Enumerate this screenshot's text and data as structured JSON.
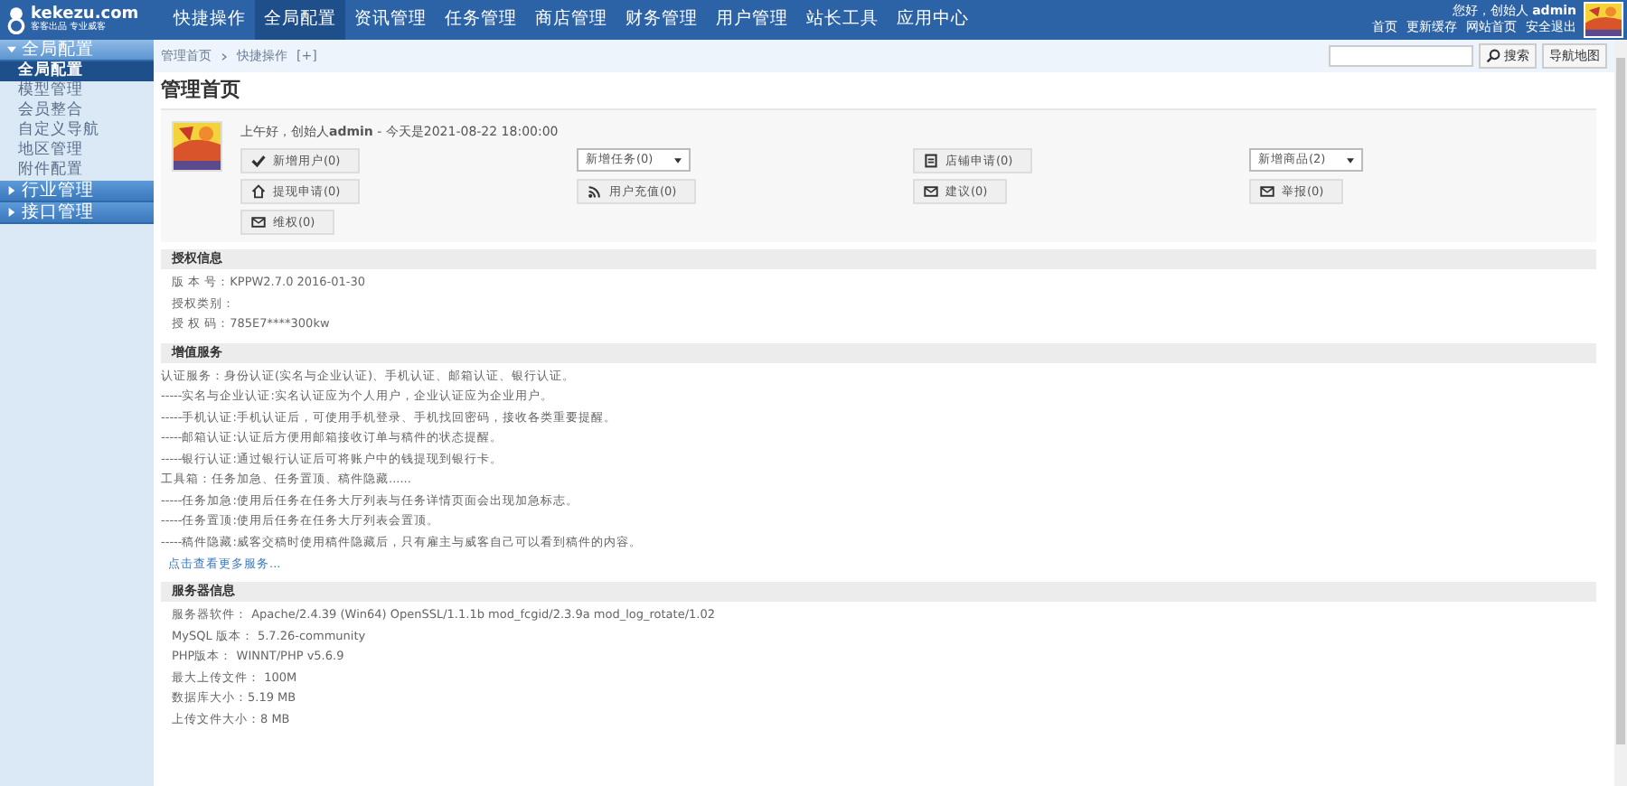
{
  "logo": {
    "name": "kekezu.com",
    "tagline": "客客出品 专业威客"
  },
  "top_nav": [
    {
      "label": "快捷操作",
      "selected": false
    },
    {
      "label": "全局配置",
      "selected": true
    },
    {
      "label": "资讯管理",
      "selected": false
    },
    {
      "label": "任务管理",
      "selected": false
    },
    {
      "label": "商店管理",
      "selected": false
    },
    {
      "label": "财务管理",
      "selected": false
    },
    {
      "label": "用户管理",
      "selected": false
    },
    {
      "label": "站长工具",
      "selected": false
    },
    {
      "label": "应用中心",
      "selected": false
    }
  ],
  "user_bar": {
    "greeting": "您好，创始人",
    "username": "admin",
    "links": [
      "首页",
      "更新缓存",
      "网站首页",
      "安全退出"
    ]
  },
  "sidebar": [
    {
      "label": "全局配置",
      "expanded": true,
      "children": [
        {
          "label": "全局配置",
          "selected": true
        },
        {
          "label": "模型管理",
          "selected": false
        },
        {
          "label": "会员整合",
          "selected": false
        },
        {
          "label": "自定义导航",
          "selected": false
        },
        {
          "label": "地区管理",
          "selected": false
        },
        {
          "label": "附件配置",
          "selected": false
        }
      ]
    },
    {
      "label": "行业管理",
      "expanded": false
    },
    {
      "label": "接口管理",
      "expanded": false
    }
  ],
  "breadcrumb": [
    "管理首页",
    "快捷操作"
  ],
  "breadcrumb_toggle": "[+]",
  "search": {
    "button": "搜索",
    "map_button": "导航地图"
  },
  "page_title": "管理首页",
  "dashboard": {
    "greeting": "上午好，创始人**admin** - 今天是2021-08-22 18:00:00",
    "actions": [
      {
        "kind": "button",
        "label": "新增用户(0)"
      },
      {
        "kind": "select",
        "label": "新增任务(0)"
      },
      {
        "kind": "button",
        "label": "店铺申请(0)"
      },
      {
        "kind": "select",
        "label": "新增商品(2)"
      },
      {
        "kind": "button",
        "label": "提现申请(0)"
      },
      {
        "kind": "button",
        "label": "用户充值(0)"
      },
      {
        "kind": "button",
        "label": "建议(0)"
      },
      {
        "kind": "button",
        "label": "举报(0)"
      },
      {
        "kind": "button",
        "label": "维权(0)"
      }
    ]
  },
  "sections": [
    {
      "title": "授权信息",
      "lines": [
        "版 本 号：KPPW2.7.0 2016-01-30",
        "授权类别：",
        "授 权 码：785E7****300kw"
      ]
    },
    {
      "title": "增值服务",
      "lines": [
        "认证服务：身份认证(实名与企业认证)、手机认证、邮箱认证、银行认证。",
        "-----实名与企业认证:实名认证应为个人用户，企业认证应为企业用户。",
        "-----手机认证:手机认证后，可使用手机登录、手机找回密码，接收各类重要提醒。",
        "-----邮箱认证:认证后方便用邮箱接收订单与稿件的状态提醒。",
        "-----银行认证:通过银行认证后可将账户中的钱提现到银行卡。",
        "工具箱：任务加急、任务置顶、稿件隐藏......",
        "-----任务加急:使用后任务在任务大厅列表与任务详情页面会出现加急标志。",
        "-----任务置顶:使用后任务在任务大厅列表会置顶。",
        "-----稿件隐藏:威客交稿时使用稿件隐藏后，只有雇主与威客自己可以看到稿件的内容。"
      ],
      "link": "点击查看更多服务..."
    },
    {
      "title": "服务器信息",
      "lines": [
        "服务器软件： Apache/2.4.39 (Win64) OpenSSL/1.1.1b mod_fcgid/2.3.9a mod_log_rotate/1.02",
        "MySQL 版本： 5.7.26-community",
        "PHP版本： WINNT/PHP v5.6.9",
        "最大上传文件： 100M",
        "数据库大小：5.19 MB",
        "上传文件大小：8 MB"
      ]
    }
  ]
}
